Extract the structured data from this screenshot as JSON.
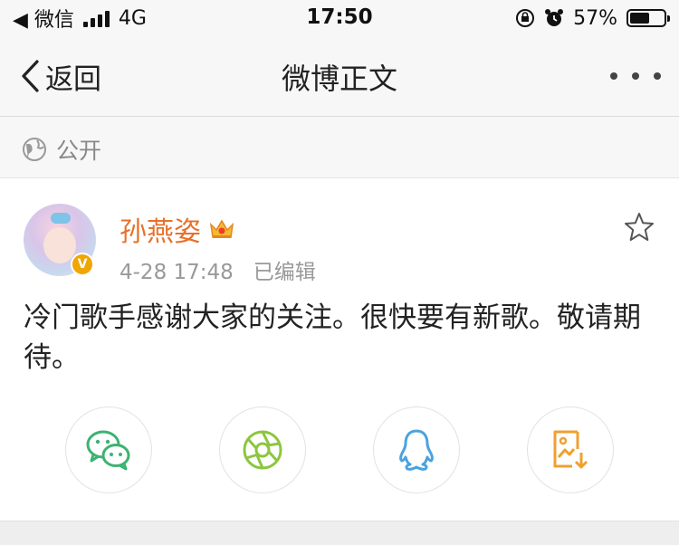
{
  "status_bar": {
    "back_app": "◀ 微信",
    "network": "4G",
    "time": "17:50",
    "battery_text": "57%",
    "battery_level": 0.57
  },
  "nav": {
    "back_label": "返回",
    "title": "微博正文"
  },
  "visibility": {
    "label": "公开"
  },
  "post": {
    "author": "孙燕姿",
    "date": "4-28 17:48",
    "edited": "已编辑",
    "verified_badge": "V",
    "text": "冷门歌手感谢大家的关注。很快要有新歌。敬请期待。"
  },
  "share": [
    {
      "icon": "wechat-icon",
      "color": "#3cb371"
    },
    {
      "icon": "moments-icon",
      "color": "#8cc63f"
    },
    {
      "icon": "qq-icon",
      "color": "#4aa3df"
    },
    {
      "icon": "save-image-icon",
      "color": "#f0a030"
    }
  ],
  "colors": {
    "author": "#e8702a",
    "meta": "#999999",
    "badge": "#f0a500"
  }
}
